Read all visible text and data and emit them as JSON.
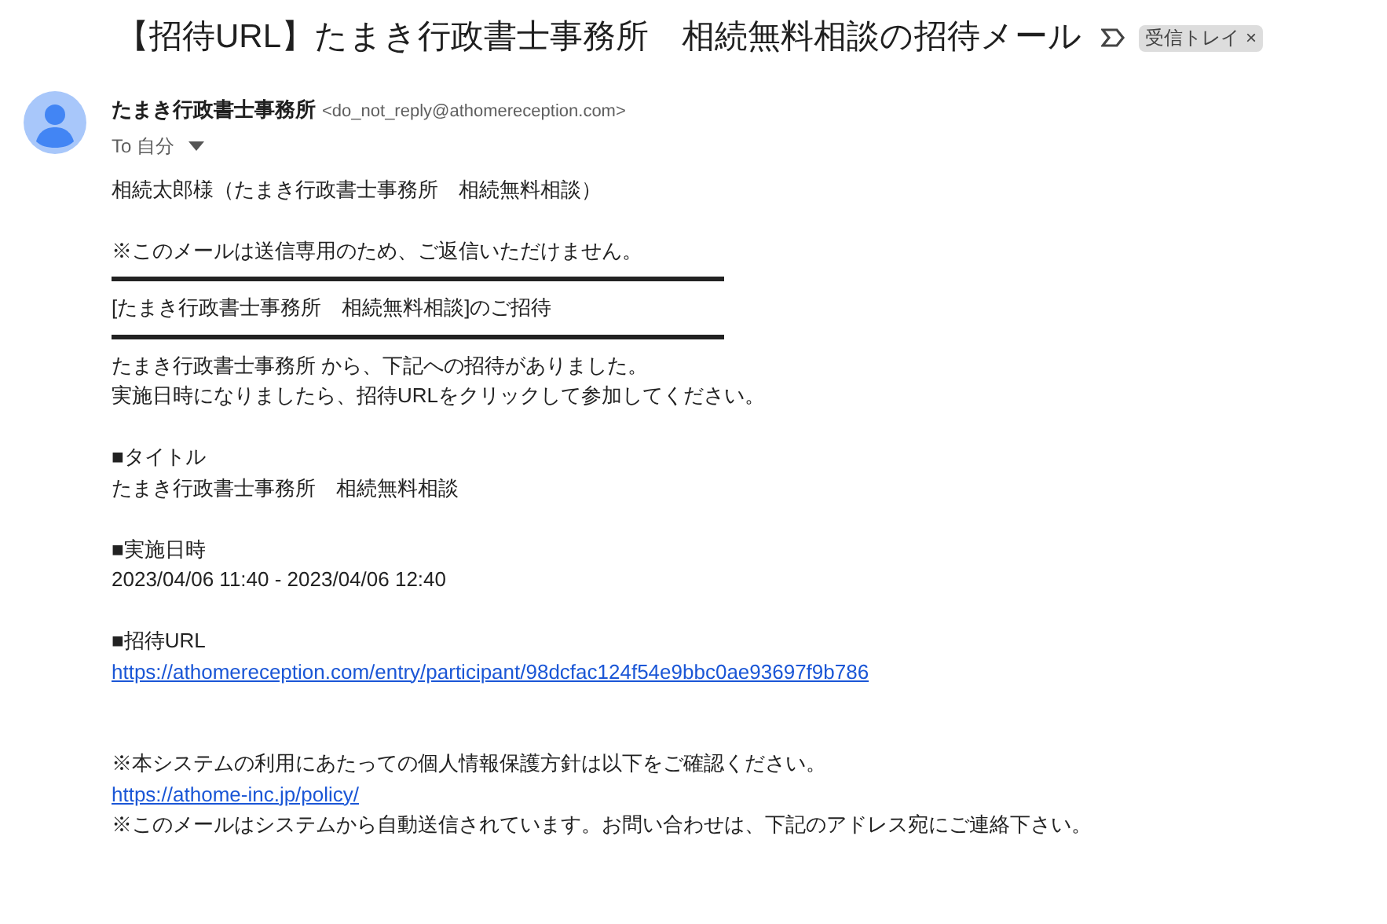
{
  "subject": "【招待URL】たまき行政書士事務所　相続無料相談の招待メール",
  "label": {
    "text": "受信トレイ",
    "close": "×"
  },
  "sender": {
    "name": "たまき行政書士事務所",
    "address": "<do_not_reply@athomereception.com>",
    "to": "To 自分"
  },
  "body": [
    {
      "kind": "text",
      "text": "相続太郎様（たまき行政書士事務所　相続無料相談）"
    },
    {
      "kind": "blank"
    },
    {
      "kind": "text",
      "text": "※このメールは送信専用のため、ご返信いただけません。"
    },
    {
      "kind": "rule"
    },
    {
      "kind": "text",
      "text": "[たまき行政書士事務所　相続無料相談]のご招待"
    },
    {
      "kind": "rule"
    },
    {
      "kind": "text",
      "text": "たまき行政書士事務所 から、下記への招待がありました。"
    },
    {
      "kind": "text",
      "text": "実施日時になりましたら、招待URLをクリックして参加してください。"
    },
    {
      "kind": "blank"
    },
    {
      "kind": "text",
      "text": "■タイトル"
    },
    {
      "kind": "text",
      "text": "たまき行政書士事務所　相続無料相談"
    },
    {
      "kind": "blank"
    },
    {
      "kind": "text",
      "text": "■実施日時"
    },
    {
      "kind": "text",
      "text": "2023/04/06 11:40 - 2023/04/06 12:40"
    },
    {
      "kind": "blank"
    },
    {
      "kind": "text",
      "text": "■招待URL"
    },
    {
      "kind": "link",
      "text": "https://athomereception.com/entry/participant/98dcfac124f54e9bbc0ae93697f9b786"
    },
    {
      "kind": "blank"
    },
    {
      "kind": "blank"
    },
    {
      "kind": "text",
      "text": "※本システムの利用にあたっての個人情報保護方針は以下をご確認ください。"
    },
    {
      "kind": "link",
      "text": "https://athome-inc.jp/policy/"
    },
    {
      "kind": "text",
      "text": "※このメールはシステムから自動送信されています。お問い合わせは、下記のアドレス宛にご連絡下さい。"
    }
  ]
}
